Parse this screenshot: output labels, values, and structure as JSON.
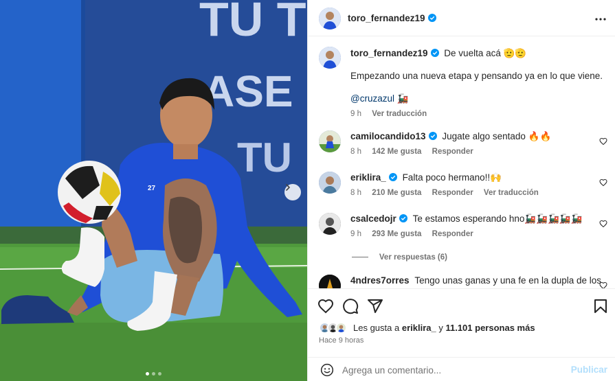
{
  "post": {
    "author": "toro_fernandez19",
    "verified": true,
    "caption_author": "toro_fernandez19",
    "caption_title": "De vuelta acá 🫡🫡",
    "caption_body": "Empezando una nueva etapa y pensando ya en lo que viene.",
    "caption_mention": "@cruzazul",
    "caption_emoji": "🚂",
    "caption_time": "9 h",
    "caption_translate": "Ver traducción",
    "image": {
      "wall_text_line1": "TU T",
      "wall_text_line2": "ASE",
      "wall_text_line3": "TU",
      "shirt_number": "27",
      "carousel_total": 3,
      "carousel_active": 1
    }
  },
  "comments": [
    {
      "username": "camilocandido13",
      "verified": true,
      "text": "Jugate algo sentado 🔥🔥",
      "time": "8 h",
      "likes": "142 Me gusta",
      "reply": "Responder",
      "translate": ""
    },
    {
      "username": "eriklira_",
      "verified": true,
      "text": "Falta poco hermano!!🙌",
      "time": "8 h",
      "likes": "210 Me gusta",
      "reply": "Responder",
      "translate": "Ver traducción"
    },
    {
      "username": "csalcedojr",
      "verified": true,
      "text": "Te estamos esperando hno🚂🚂🚂🚂🚂",
      "time": "9 h",
      "likes": "293 Me gusta",
      "reply": "Responder",
      "translate": "",
      "view_replies": "Ver respuestas (6)"
    },
    {
      "username": "4ndres7orres",
      "verified": false,
      "text": "Tengo unas ganas y una fe en la dupla de los"
    }
  ],
  "likes": {
    "prefix": "Les gusta a",
    "user": "eriklira_",
    "joiner": "y",
    "count": "11.101 personas más",
    "time_ago": "Hace 9 horas"
  },
  "composer": {
    "placeholder": "Agrega un comentario...",
    "post_label": "Publicar"
  },
  "colors": {
    "verified": "#0095f6",
    "link": "#00376b",
    "muted": "#737373",
    "publish_disabled": "#b2dffc"
  },
  "icons": {
    "more": "ellipsis-icon",
    "like": "heart-icon",
    "comment": "comment-bubble-icon",
    "share": "paper-plane-icon",
    "save": "bookmark-icon",
    "emoji": "smiley-icon",
    "next": "chevron-right-icon"
  }
}
